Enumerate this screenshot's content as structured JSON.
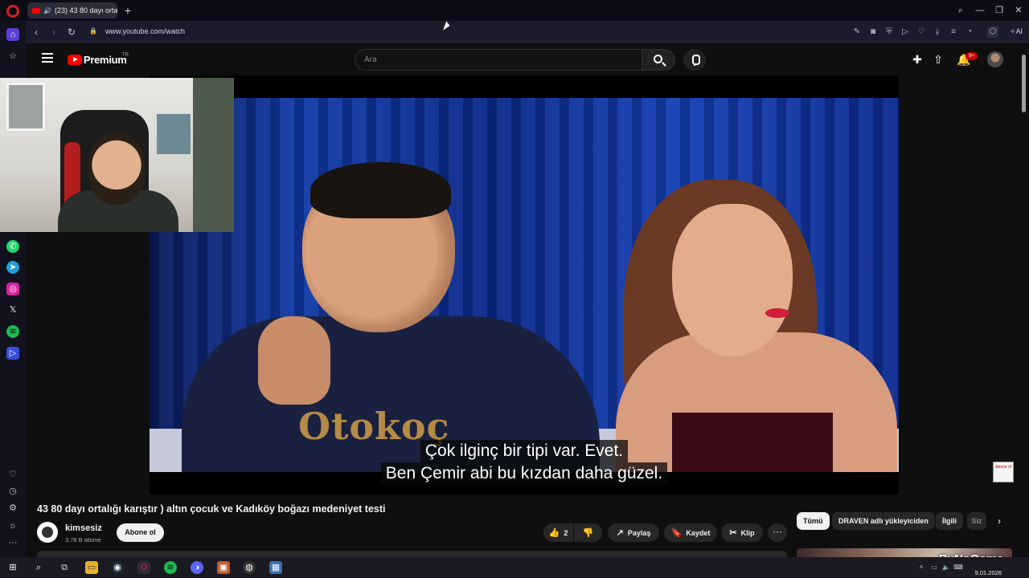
{
  "browser": {
    "tab_title": "(23) 43 80 dayı ortalığ",
    "new_tab": "+",
    "url": "www.youtube.com/watch",
    "ai_label": "AI",
    "window_controls": [
      "search-icon",
      "minimize-icon",
      "restore-icon",
      "close-icon"
    ],
    "nav": {
      "back": "‹",
      "forward": "›",
      "reload": "↻"
    },
    "extensions": [
      "edit-icon",
      "camera-icon",
      "shield-icon",
      "play-icon",
      "heart-icon",
      "download-icon",
      "menu-icon",
      "profile-icon",
      "cube-icon"
    ]
  },
  "sidebar": {
    "top_items": [
      "home-icon",
      "star-icon"
    ],
    "apps": [
      "whatsapp-icon",
      "telegram-icon",
      "instagram-icon",
      "x-icon",
      "spotify-icon",
      "player-icon"
    ],
    "bottom_items": [
      "heart-icon",
      "history-icon",
      "settings-icon",
      "lightbulb-icon",
      "more-icon"
    ]
  },
  "youtube": {
    "brand": "Premium",
    "region": "TR",
    "search_placeholder": "Ara",
    "notification_count": "9+",
    "header_icons": [
      "create-icon",
      "upload-icon",
      "bell-icon"
    ]
  },
  "player": {
    "subtitle_line1": "Çok ilginç bir tipi var. Evet.",
    "subtitle_line2": "Ben Çemir abi bu kızdan daha güzel.",
    "jersey_text": "Otokoç",
    "subscribe_watermark": "Abone ol"
  },
  "video": {
    "title": "43 80 dayı ortalığı karıştır ) altın çocuk ve Kadıköy boğazı medeniyet testi",
    "channel": "kimsesiz",
    "subscribers": "3,78 B abone",
    "subscribe_label": "Abone ol",
    "like_count": "2",
    "share_label": "Paylaş",
    "save_label": "Kaydet",
    "clip_label": "Klip",
    "more_label": "···"
  },
  "chips": [
    "Tümü",
    "DRAVEN adlı yükleyiciden",
    "İlgili",
    "Siz"
  ],
  "watermark": "ByNoGame",
  "taskbar": {
    "apps": [
      "windows-icon",
      "search-icon",
      "taskview-icon",
      "explorer-icon",
      "steam-icon",
      "opera-icon",
      "spotify-icon",
      "discord-icon",
      "obs-icon",
      "app-icon",
      "calculator-icon"
    ],
    "time": "",
    "date": "9.01.2026"
  }
}
